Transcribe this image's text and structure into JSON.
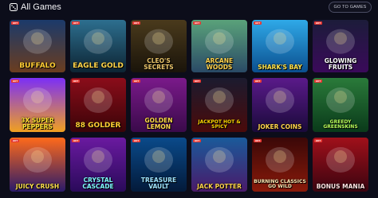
{
  "header": {
    "title": "All Games",
    "goto_label": "GO TO GAMES",
    "icon": "dice-icon"
  },
  "badge_label": "HOT",
  "games": [
    {
      "name": "BUFFALO",
      "colors": [
        "#1b3a6b",
        "#6b3d1f"
      ],
      "text": "#ffcc33"
    },
    {
      "name": "EAGLE GOLD",
      "colors": [
        "#2d6f8f",
        "#0d2433"
      ],
      "text": "#ffd54a"
    },
    {
      "name": "CLEO'S SECRETS",
      "colors": [
        "#4a3a1c",
        "#1a140a"
      ],
      "text": "#e9c46a"
    },
    {
      "name": "ARCANE WOODS",
      "colors": [
        "#5aa27a",
        "#2a4a66"
      ],
      "text": "#ffd34d"
    },
    {
      "name": "SHARK'S BAY",
      "colors": [
        "#2fa9e8",
        "#0b4f8f"
      ],
      "text": "#ffe34d"
    },
    {
      "name": "GLOWING FRUITS",
      "colors": [
        "#1c1c3a",
        "#3a0a5a"
      ],
      "text": "#ffffff"
    },
    {
      "name": "3X SUPER PEPPERS",
      "colors": [
        "#7b2ff7",
        "#f0a020"
      ],
      "text": "#ffe033"
    },
    {
      "name": "88 GOLDER",
      "colors": [
        "#8b0d1a",
        "#3a0408"
      ],
      "text": "#ffcf33"
    },
    {
      "name": "GOLDEN LEMON",
      "colors": [
        "#7a1a8a",
        "#3a0a4a"
      ],
      "text": "#ffd84a"
    },
    {
      "name": "JACKPOT HOT & SPICY",
      "colors": [
        "#1b1b2f",
        "#4a0a0a"
      ],
      "text": "#ffd700"
    },
    {
      "name": "JOKER COINS",
      "colors": [
        "#5a1a8a",
        "#1a0a3a"
      ],
      "text": "#ffd34d"
    },
    {
      "name": "GREEDY GREENSKINS",
      "colors": [
        "#2a7a3a",
        "#0a3a1a"
      ],
      "text": "#b9ff5a"
    },
    {
      "name": "JUICY CRUSH",
      "colors": [
        "#ff6a1a",
        "#2a1a6a"
      ],
      "text": "#ffe14d"
    },
    {
      "name": "CRYSTAL CASCADE",
      "colors": [
        "#6a1aa0",
        "#2a0a5a"
      ],
      "text": "#7ff7ff"
    },
    {
      "name": "TREASURE VAULT",
      "colors": [
        "#0a4a8a",
        "#031a3a"
      ],
      "text": "#9fe4ff"
    },
    {
      "name": "JACK POTTER",
      "colors": [
        "#1a5a9a",
        "#4a1a6a"
      ],
      "text": "#ffd34d"
    },
    {
      "name": "BURNING CLASSICS GO WILD",
      "colors": [
        "#3a0808",
        "#8a1a0a"
      ],
      "text": "#ffe6b0"
    },
    {
      "name": "BONUS MANIA",
      "colors": [
        "#a0101a",
        "#3a0410"
      ],
      "text": "#ffe0e0"
    }
  ]
}
